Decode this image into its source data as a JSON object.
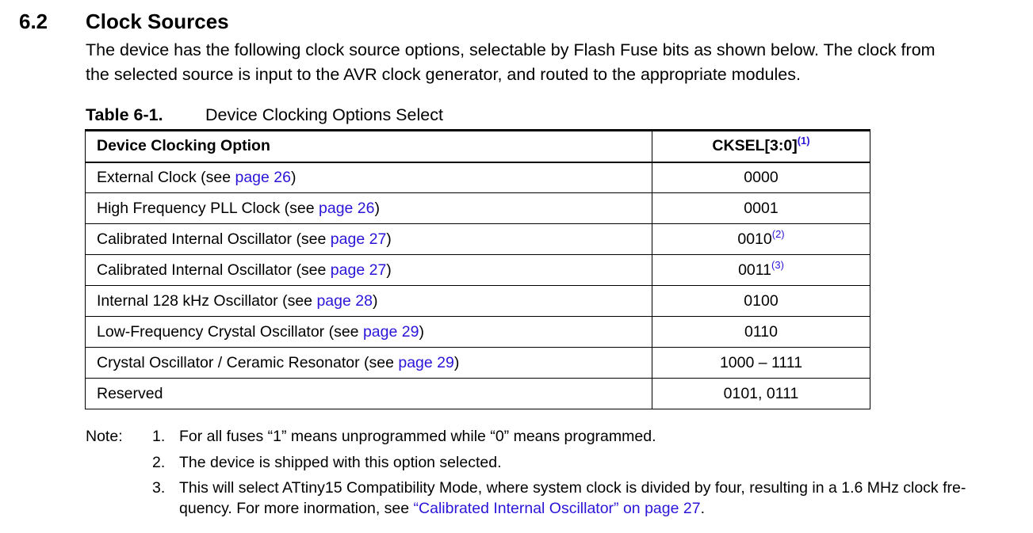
{
  "section": {
    "number": "6.2",
    "title": "Clock Sources",
    "intro_line1": "The device has the following clock source options, selectable by Flash Fuse bits as shown below. The clock from",
    "intro_line2": "the selected source is input to the AVR clock generator, and routed to the appropriate modules."
  },
  "table": {
    "caption_label": "Table 6-1.",
    "caption_text": "Device Clocking Options Select",
    "headers": {
      "option": "Device Clocking Option",
      "cksel": "CKSEL[3:0]",
      "cksel_sup": "(1)"
    },
    "rows": [
      {
        "text": "External Clock (see ",
        "link": "page 26",
        "close": ")",
        "value": "0000",
        "sup": ""
      },
      {
        "text": "High Frequency PLL Clock (see ",
        "link": "page 26",
        "close": ")",
        "value": "0001",
        "sup": ""
      },
      {
        "text": "Calibrated Internal Oscillator (see ",
        "link": "page 27",
        "close": ")",
        "value": "0010",
        "sup": "(2)"
      },
      {
        "text": "Calibrated Internal Oscillator (see ",
        "link": "page 27",
        "close": ")",
        "value": "0011",
        "sup": "(3)"
      },
      {
        "text": "Internal 128 kHz Oscillator (see ",
        "link": "page 28",
        "close": ")",
        "value": "0100",
        "sup": ""
      },
      {
        "text": "Low-Frequency Crystal Oscillator (see ",
        "link": "page 29",
        "close": ")",
        "value": "0110",
        "sup": ""
      },
      {
        "text": "Crystal Oscillator / Ceramic Resonator (see ",
        "link": "page 29",
        "close": ")",
        "value": "1000 – 1111",
        "sup": ""
      },
      {
        "text": "Reserved",
        "link": "",
        "close": "",
        "value": "0101, 0111",
        "sup": ""
      }
    ]
  },
  "notes": {
    "label": "Note:",
    "items": [
      {
        "num": "1.",
        "text": "For all fuses “1” means unprogrammed while “0” means programmed."
      },
      {
        "num": "2.",
        "text": "The device is shipped with this option selected."
      },
      {
        "num": "3.",
        "text": "This will select ATtiny15 Compatibility Mode, where system clock is divided by four, resulting in a 1.6 MHz clock fre-",
        "text2": "quency. For more inormation, see ",
        "link": "“Calibrated Internal Oscillator” on page 27",
        "end": "."
      }
    ]
  },
  "colors": {
    "link": "#2a15d8",
    "text": "#000000",
    "background": "#ffffff"
  }
}
